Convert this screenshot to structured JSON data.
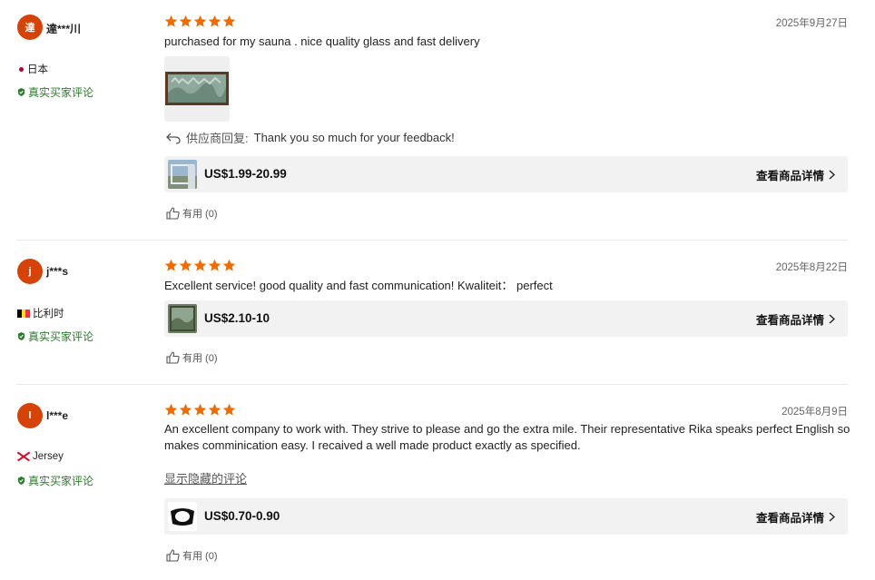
{
  "colors": {
    "star": "#f56a00",
    "verified": "#2c7a2c",
    "avatar": "#d54309",
    "bar": "#f2f2f2"
  },
  "icons": {
    "star": "star-icon",
    "reply": "reply-arrow-icon",
    "like": "thumbs-up-icon",
    "chevron": "chevron-right-icon",
    "verified": "verified-shield-icon"
  },
  "reviews": [
    {
      "avatar_letter": "達",
      "username": "達***川",
      "country": "日本",
      "verified": "真实买家评论",
      "rating": 5,
      "date": "2025年9月27日",
      "text": "purchased for my sauna . nice quality glass and fast delivery",
      "reply_label": "供应商回复:",
      "reply_text": "Thank you so much for your feedback!",
      "price": "US$1.99-20.99",
      "details_label": "查看商品详情",
      "helpful": "有用 (0)"
    },
    {
      "avatar_letter": "j",
      "username": "j***s",
      "country": "比利时",
      "verified": "真实买家评论",
      "rating": 5,
      "date": "2025年8月22日",
      "text": "Excellent service!  good quality and fast communication! Kwaliteit： perfect",
      "price": "US$2.10-10",
      "details_label": "查看商品详情",
      "helpful": "有用 (0)"
    },
    {
      "avatar_letter": "l",
      "username": "l***e",
      "country": "Jersey",
      "verified": "真实买家评论",
      "rating": 5,
      "date": "2025年8月9日",
      "text": "An excellent company to work with. They strive to please and go the extra mile. Their representative Rika speaks perfect English so makes comminication easy. I recaived a well made product exactly as specified.",
      "show_hidden": "显示隐藏的评论",
      "price": "US$0.70-0.90",
      "details_label": "查看商品详情",
      "helpful": "有用 (0)"
    }
  ]
}
